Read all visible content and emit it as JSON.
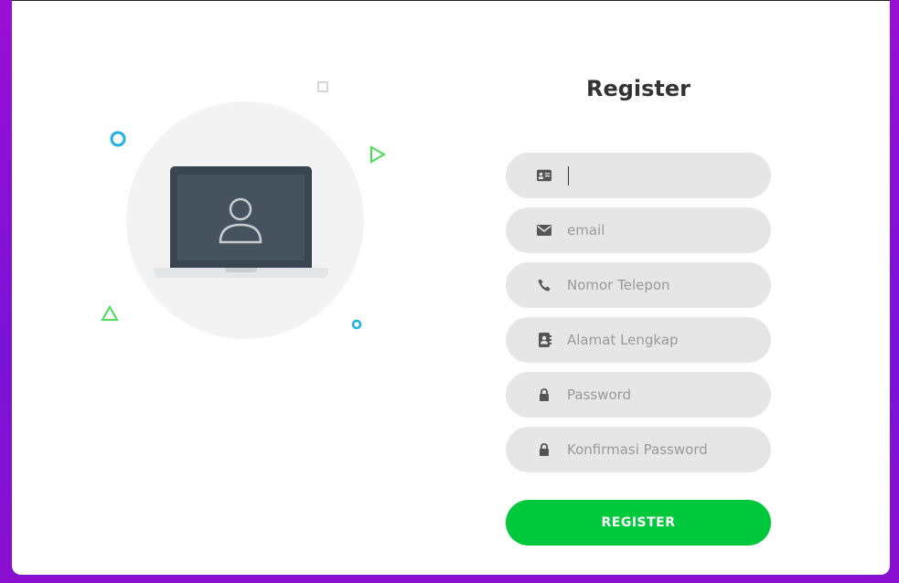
{
  "form": {
    "title": "Register",
    "fields": [
      {
        "icon": "id-card-icon",
        "placeholder": "",
        "value": ""
      },
      {
        "icon": "envelope-icon",
        "placeholder": "email",
        "value": ""
      },
      {
        "icon": "phone-icon",
        "placeholder": "Nomor Telepon",
        "value": ""
      },
      {
        "icon": "address-book-icon",
        "placeholder": "Alamat Lengkap",
        "value": ""
      },
      {
        "icon": "lock-icon",
        "placeholder": "Password",
        "value": ""
      },
      {
        "icon": "lock-icon",
        "placeholder": "Konfirmasi Password",
        "value": ""
      }
    ],
    "submit_label": "REGISTER"
  },
  "colors": {
    "accent": "#00c83c",
    "background_gradient": [
      "#9a0fd6",
      "#7a12d8"
    ],
    "field_bg": "#e6e6e6"
  }
}
